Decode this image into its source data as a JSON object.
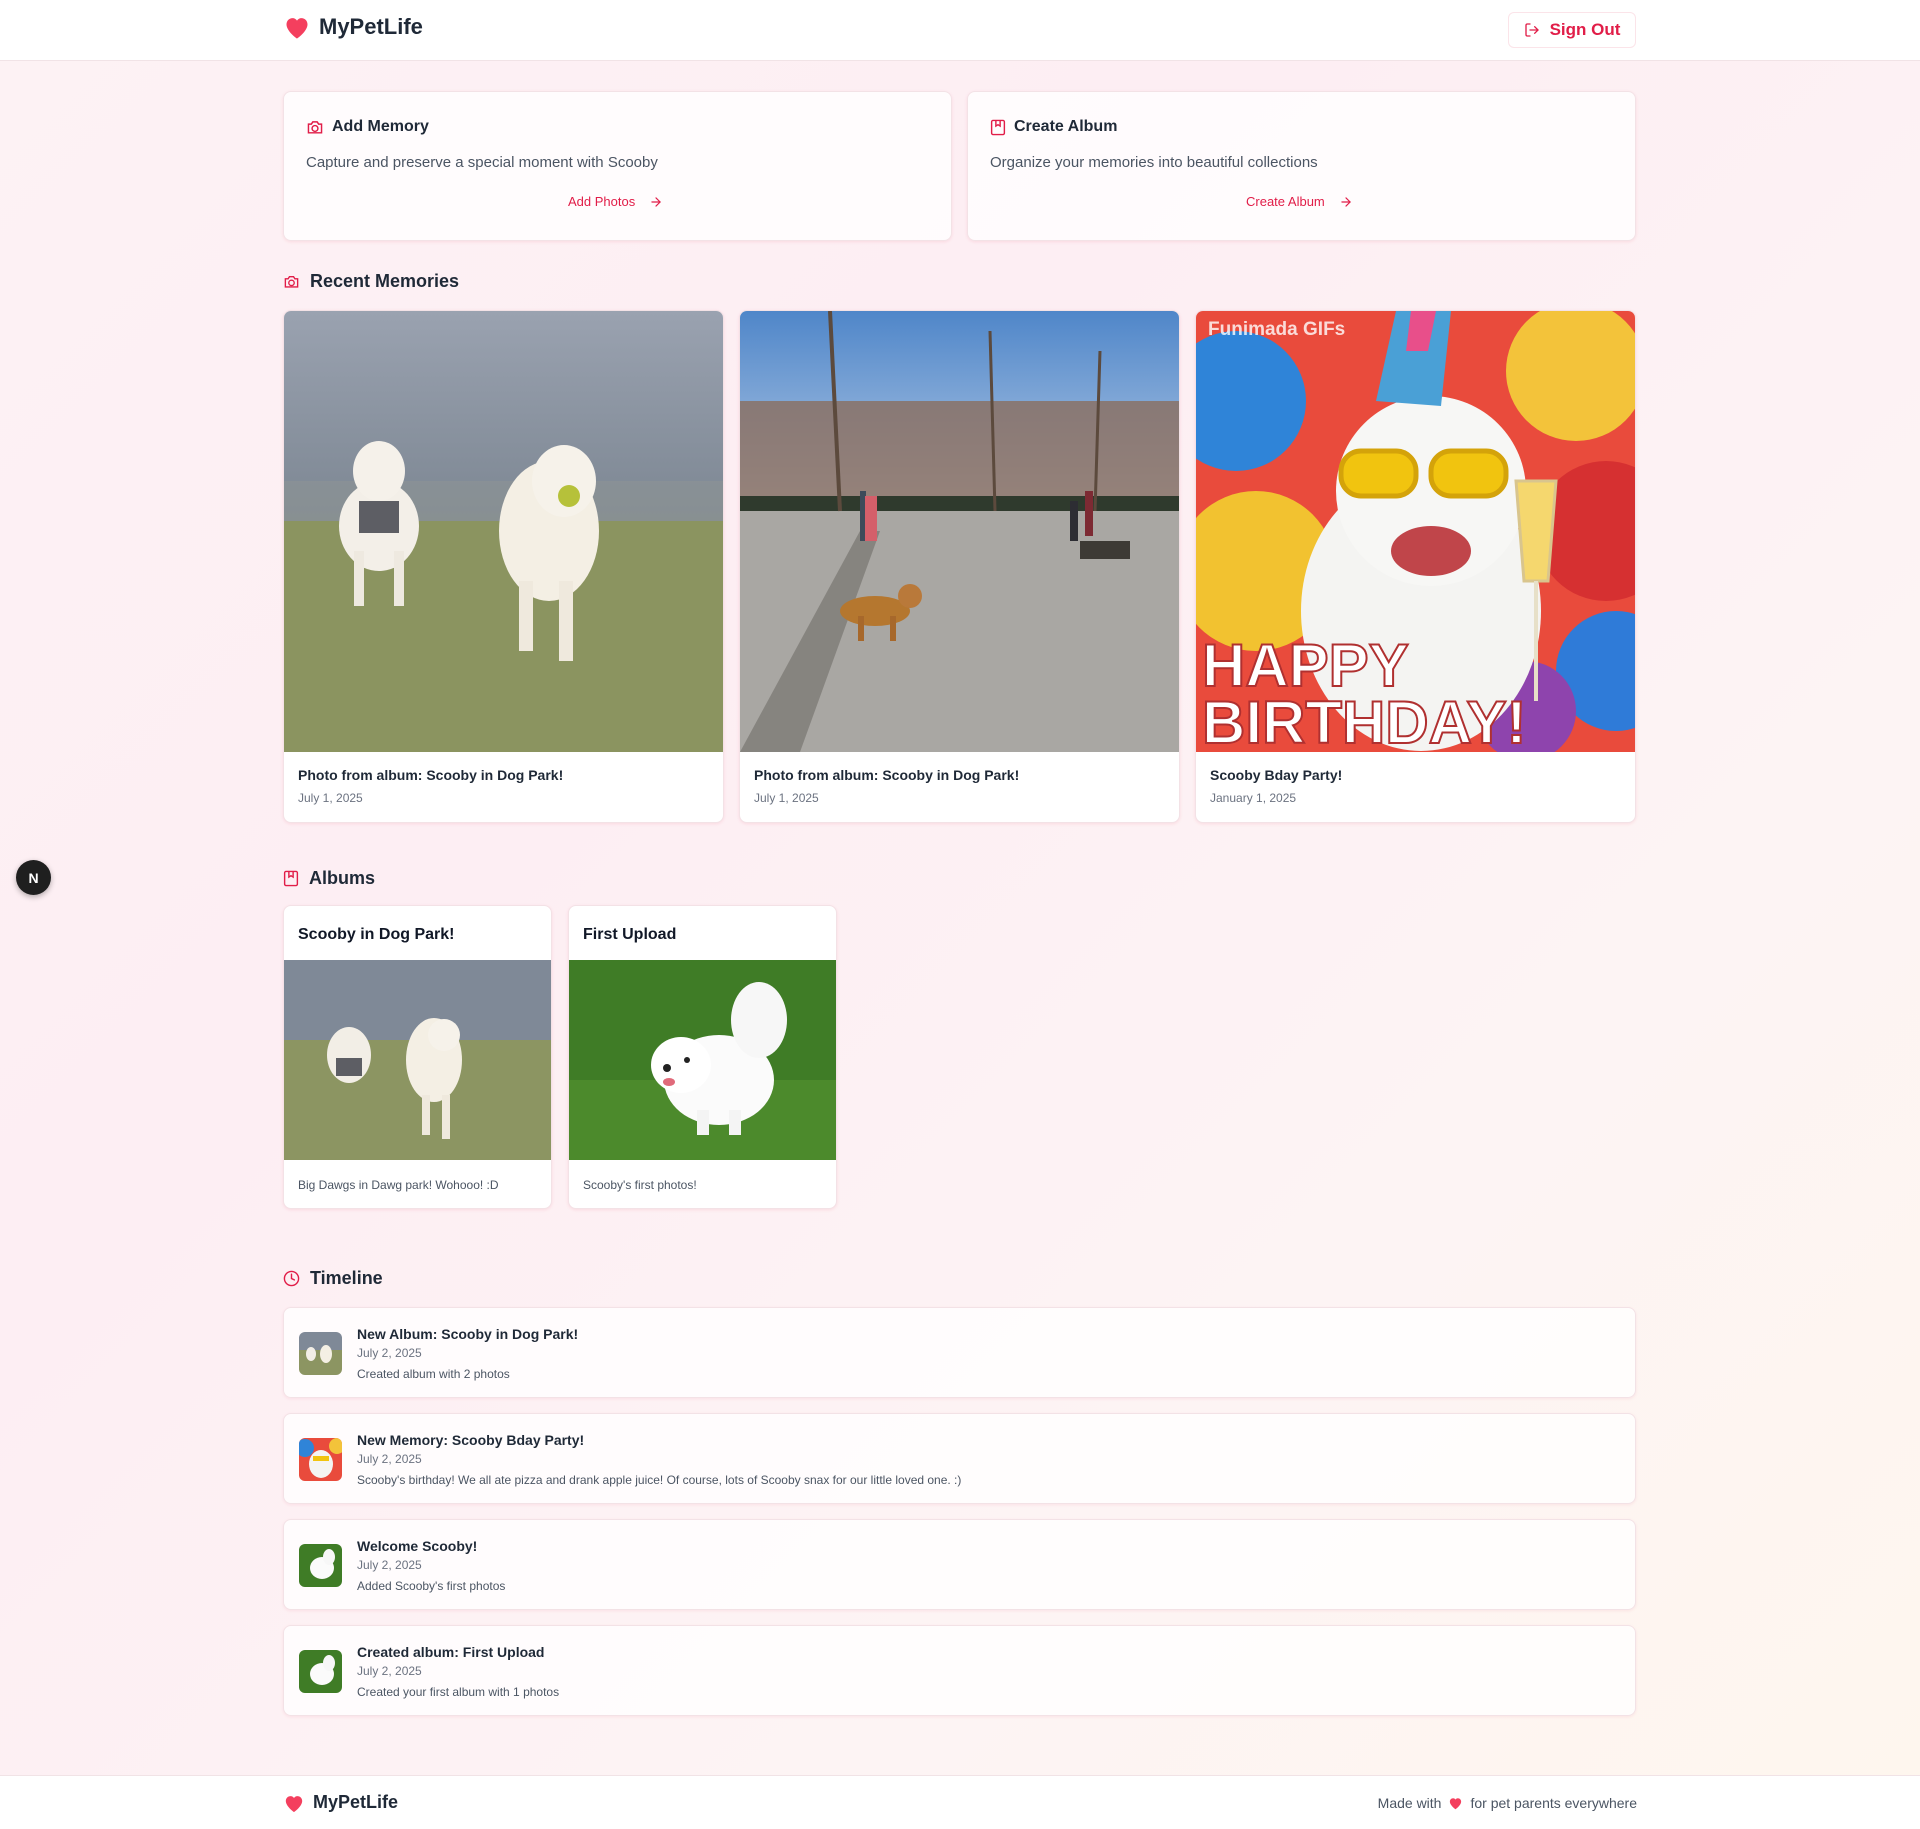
{
  "header": {
    "app_name": "MyPetLife",
    "sign_out_label": "Sign Out"
  },
  "actions": {
    "add_memory": {
      "title": "Add Memory",
      "description": "Capture and preserve a special moment with Scooby",
      "link_label": "Add Photos"
    },
    "create_album": {
      "title": "Create Album",
      "description": "Organize your memories into beautiful collections",
      "link_label": "Create Album"
    }
  },
  "recent_memories": {
    "heading": "Recent Memories",
    "items": [
      {
        "caption": "Photo from album: Scooby in Dog Park!",
        "date": "July 1, 2025"
      },
      {
        "caption": "Photo from album: Scooby in Dog Park!",
        "date": "July 1, 2025"
      },
      {
        "caption": "Scooby Bday Party!",
        "date": "January 1, 2025",
        "image_watermark": "Funimada GIFs",
        "image_text": [
          "HAPPY",
          "BIRTHDAY!"
        ]
      }
    ]
  },
  "albums": {
    "heading": "Albums",
    "items": [
      {
        "name": "Scooby in Dog Park!",
        "description": "Big Dawgs in Dawg park! Wohooo! :D"
      },
      {
        "name": "First Upload",
        "description": "Scooby's first photos!"
      }
    ]
  },
  "timeline": {
    "heading": "Timeline",
    "items": [
      {
        "title": "New Album: Scooby in Dog Park!",
        "date": "July 2, 2025",
        "text": "Created album with 2 photos"
      },
      {
        "title": "New Memory: Scooby Bday Party!",
        "date": "July 2, 2025",
        "text": "Scooby's birthday! We all ate pizza and drank apple juice! Of course, lots of Scooby snax for our little loved one. :)"
      },
      {
        "title": "Welcome Scooby!",
        "date": "July 2, 2025",
        "text": "Added Scooby's first photos"
      },
      {
        "title": "Created album: First Upload",
        "date": "July 2, 2025",
        "text": "Created your first album with 1 photos"
      }
    ]
  },
  "footer": {
    "app_name": "MyPetLife",
    "made_with": "Made with",
    "tagline": "for pet parents everywhere"
  },
  "dev_badge": {
    "letter": "N"
  },
  "colors": {
    "accent": "#e11d48",
    "heart": "#f43f5e"
  }
}
